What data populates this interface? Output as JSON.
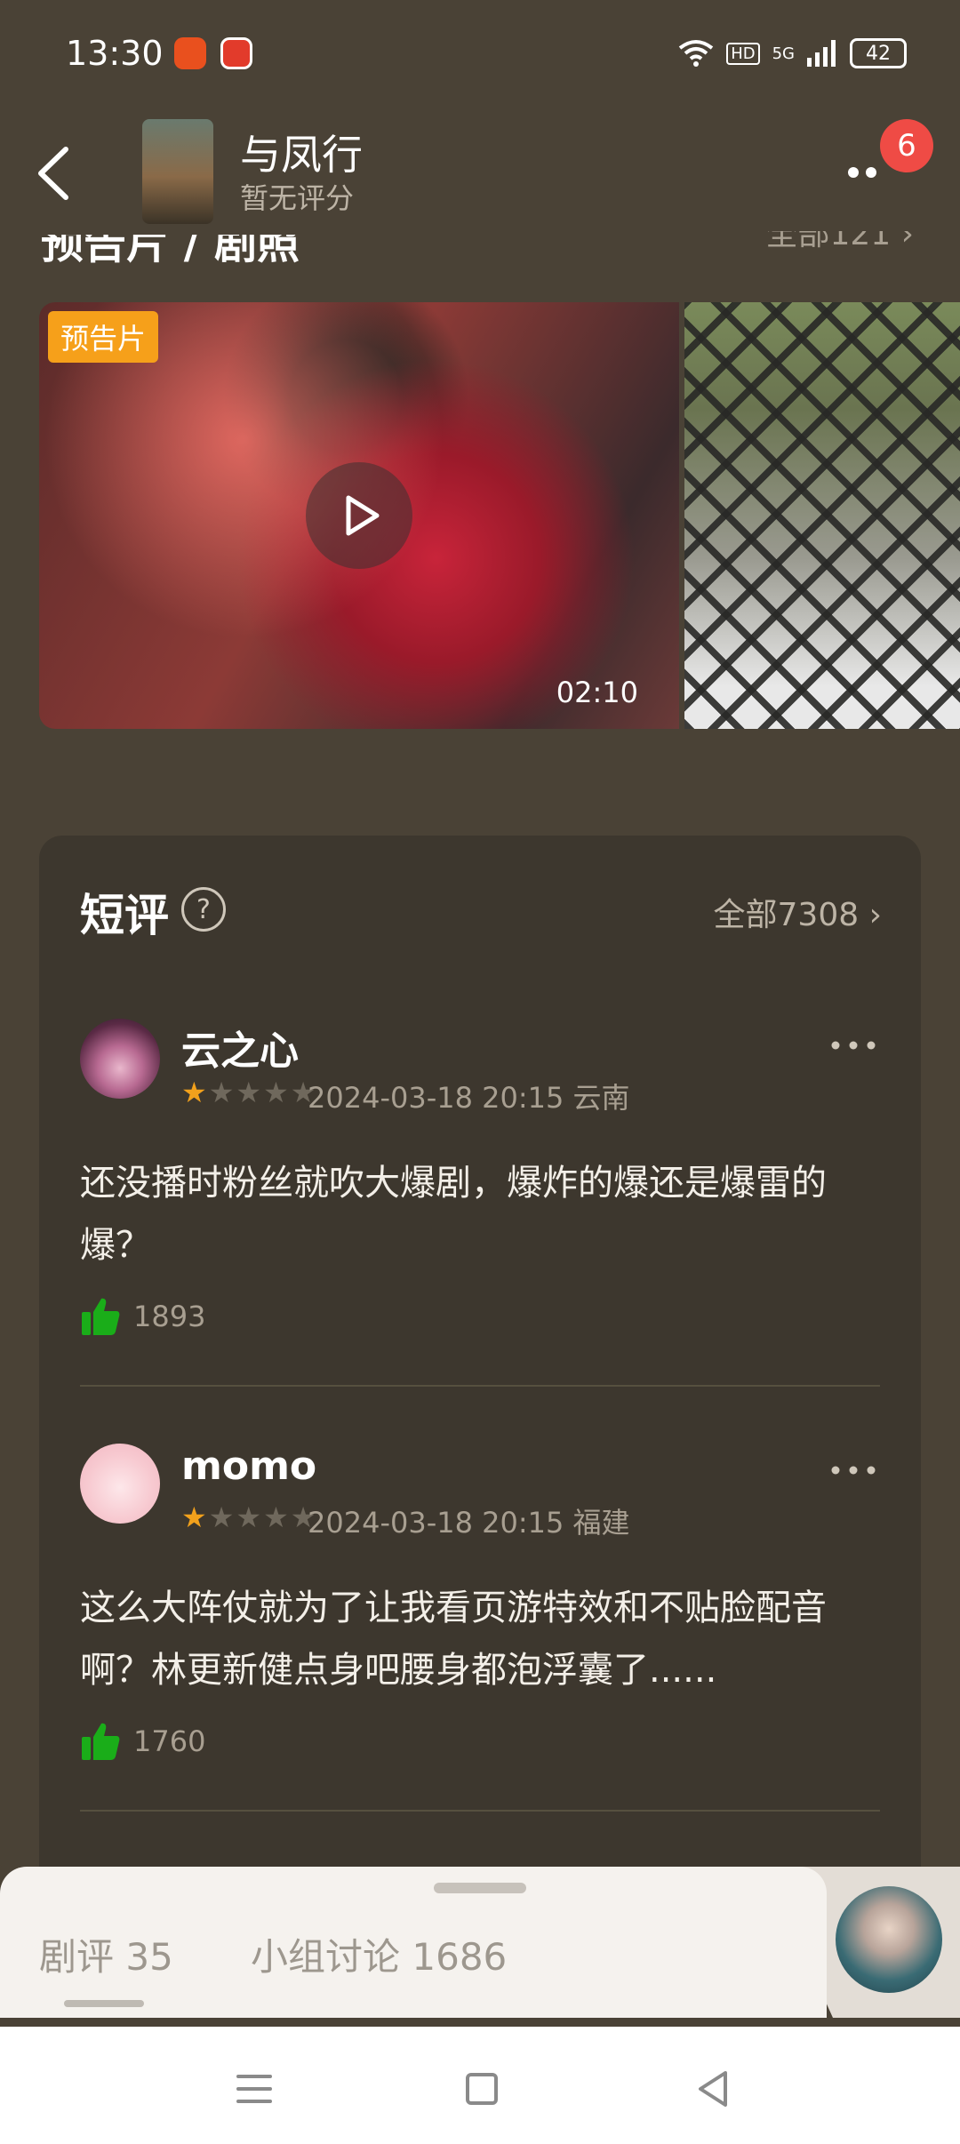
{
  "status_bar": {
    "time": "13:30",
    "network": "5G",
    "hd": "HD",
    "battery": "42"
  },
  "header": {
    "title": "与凤行",
    "subtitle": "暂无评分",
    "notification_count": "6"
  },
  "media_section": {
    "title_partial": "预告片 / 剧照",
    "all_partial": "全部121 ›",
    "trailer_tag": "预告片",
    "trailer_duration": "02:10"
  },
  "short_reviews": {
    "title": "短评",
    "help_icon": "?",
    "all_label": "全部7308",
    "items": [
      {
        "name": "云之心",
        "rating": 1,
        "max_rating": 5,
        "meta": "2024-03-18 20:15 云南",
        "text": "还没播时粉丝就吹大爆剧，爆炸的爆还是爆雷的爆？",
        "likes": "1893"
      },
      {
        "name": "momo",
        "rating": 1,
        "max_rating": 5,
        "meta": "2024-03-18 20:15 福建",
        "text": "这么大阵仗就为了让我看页游特效和不贴脸配音啊？林更新健点身吧腰身都泡浮囊了......",
        "likes": "1760"
      }
    ]
  },
  "bottom_sheet": {
    "tabs": [
      {
        "label": "剧评",
        "count": "35"
      },
      {
        "label": "小组讨论",
        "count": "1686"
      }
    ]
  },
  "colors": {
    "background": "#4a4236",
    "card": "#3d372e",
    "star": "#f2a11c",
    "like": "#1aad19",
    "badge": "#ef4b45",
    "tag": "#f6a01a"
  }
}
